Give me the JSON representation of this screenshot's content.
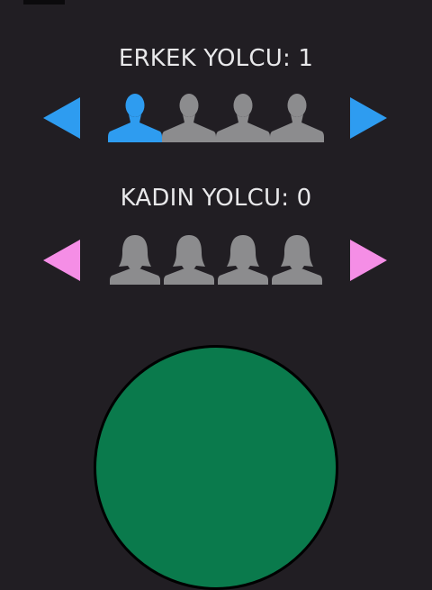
{
  "male": {
    "label": "ERKEK YOLCU: 1",
    "count": 1,
    "max": 4,
    "accent_color": "#2e9cf0",
    "arrow_icon_left": "triangle-left-icon",
    "arrow_icon_right": "triangle-right-icon",
    "figure_icon": "male-person-icon"
  },
  "female": {
    "label": "KADIN YOLCU: 0",
    "count": 0,
    "max": 4,
    "accent_color": "#f58ee6",
    "arrow_icon_left": "triangle-left-icon",
    "arrow_icon_right": "triangle-right-icon",
    "figure_icon": "female-person-icon"
  },
  "colors": {
    "background": "#211e23",
    "inactive_figure": "#8c8c8e",
    "action_button": "#0a7a4c"
  }
}
